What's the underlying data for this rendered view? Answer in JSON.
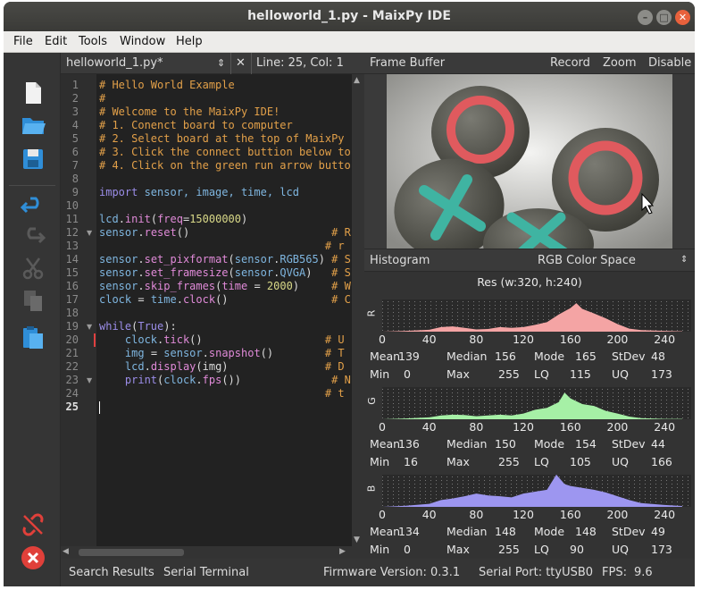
{
  "window": {
    "title": "helloworld_1.py - MaixPy IDE"
  },
  "menu": [
    "File",
    "Edit",
    "Tools",
    "Window",
    "Help"
  ],
  "toolbar_icons": [
    "new-file-icon",
    "open-folder-icon",
    "save-icon",
    "undo-icon",
    "redo-icon",
    "cut-icon",
    "copy-icon",
    "paste-icon",
    "disconnect-icon",
    "stop-icon"
  ],
  "editor": {
    "tab_label": "helloworld_1.py*",
    "position": "Line: 25, Col: 1",
    "current_line": 25,
    "lines": [
      [
        [
          "# Hello World Example",
          "comment"
        ]
      ],
      [
        [
          "#",
          "comment"
        ]
      ],
      [
        [
          "# Welcome to the MaixPy IDE!",
          "comment"
        ]
      ],
      [
        [
          "# 1. Conenct board to computer",
          "comment"
        ]
      ],
      [
        [
          "# 2. Select board at the top of MaixPy",
          "comment"
        ]
      ],
      [
        [
          "# 3. Click the connect buttion below to",
          "comment"
        ]
      ],
      [
        [
          "# 4. Click on the green run arrow butto",
          "comment"
        ]
      ],
      [],
      [
        [
          "import",
          "kw"
        ],
        [
          " sensor, image, time, lcd",
          "var"
        ]
      ],
      [],
      [
        [
          "lcd",
          "var"
        ],
        [
          ".",
          "plain"
        ],
        [
          "init",
          "fn"
        ],
        [
          "(",
          "plain"
        ],
        [
          "freq",
          "fn"
        ],
        [
          "=",
          "plain"
        ],
        [
          "15000000",
          "num"
        ],
        [
          ")",
          "plain"
        ]
      ],
      [
        [
          "sensor",
          "var"
        ],
        [
          ".",
          "plain"
        ],
        [
          "reset",
          "fn"
        ],
        [
          "()",
          "plain"
        ],
        [
          "                      ",
          "plain"
        ],
        [
          "# R",
          "comment"
        ]
      ],
      [
        [
          "                                   ",
          "plain"
        ],
        [
          "# r",
          "comment"
        ]
      ],
      [
        [
          "sensor",
          "var"
        ],
        [
          ".",
          "plain"
        ],
        [
          "set_pixformat",
          "fn"
        ],
        [
          "(",
          "plain"
        ],
        [
          "sensor",
          "var"
        ],
        [
          ".",
          "plain"
        ],
        [
          "RGB565",
          "var"
        ],
        [
          ")",
          "plain"
        ],
        [
          " ",
          "plain"
        ],
        [
          "# S",
          "comment"
        ]
      ],
      [
        [
          "sensor",
          "var"
        ],
        [
          ".",
          "plain"
        ],
        [
          "set_framesize",
          "fn"
        ],
        [
          "(",
          "plain"
        ],
        [
          "sensor",
          "var"
        ],
        [
          ".",
          "plain"
        ],
        [
          "QVGA",
          "var"
        ],
        [
          ")",
          "plain"
        ],
        [
          "   ",
          "plain"
        ],
        [
          "# S",
          "comment"
        ]
      ],
      [
        [
          "sensor",
          "var"
        ],
        [
          ".",
          "plain"
        ],
        [
          "skip_frames",
          "fn"
        ],
        [
          "(",
          "plain"
        ],
        [
          "time",
          "fn"
        ],
        [
          " = ",
          "plain"
        ],
        [
          "2000",
          "num"
        ],
        [
          ")",
          "plain"
        ],
        [
          "     ",
          "plain"
        ],
        [
          "# W",
          "comment"
        ]
      ],
      [
        [
          "clock",
          "var"
        ],
        [
          " = ",
          "plain"
        ],
        [
          "time",
          "var"
        ],
        [
          ".",
          "plain"
        ],
        [
          "clock",
          "fn"
        ],
        [
          "()",
          "plain"
        ],
        [
          "                ",
          "plain"
        ],
        [
          "# C",
          "comment"
        ]
      ],
      [],
      [
        [
          "while",
          "kw"
        ],
        [
          "(",
          "plain"
        ],
        [
          "True",
          "kw"
        ],
        [
          "):",
          "plain"
        ]
      ],
      [
        [
          "    ",
          "plain"
        ],
        [
          "clock",
          "var"
        ],
        [
          ".",
          "plain"
        ],
        [
          "tick",
          "fn"
        ],
        [
          "()",
          "plain"
        ],
        [
          "                   ",
          "plain"
        ],
        [
          "# U",
          "comment"
        ]
      ],
      [
        [
          "    ",
          "plain"
        ],
        [
          "img",
          "var"
        ],
        [
          " = ",
          "plain"
        ],
        [
          "sensor",
          "var"
        ],
        [
          ".",
          "plain"
        ],
        [
          "snapshot",
          "fn"
        ],
        [
          "()",
          "plain"
        ],
        [
          "        ",
          "plain"
        ],
        [
          "# T",
          "comment"
        ]
      ],
      [
        [
          "    ",
          "plain"
        ],
        [
          "lcd",
          "var"
        ],
        [
          ".",
          "plain"
        ],
        [
          "display",
          "fn"
        ],
        [
          "(img)",
          "plain"
        ],
        [
          "               ",
          "plain"
        ],
        [
          "# D",
          "comment"
        ]
      ],
      [
        [
          "    ",
          "plain"
        ],
        [
          "print",
          "kw"
        ],
        [
          "(",
          "plain"
        ],
        [
          "clock",
          "var"
        ],
        [
          ".",
          "plain"
        ],
        [
          "fps",
          "fn"
        ],
        [
          "())",
          "plain"
        ],
        [
          "              ",
          "plain"
        ],
        [
          "# N",
          "comment"
        ]
      ],
      [
        [
          "                                   ",
          "plain"
        ],
        [
          "# t",
          "comment"
        ]
      ],
      []
    ],
    "fold_lines": [
      12,
      19,
      23
    ]
  },
  "frame_buffer": {
    "label": "Frame Buffer",
    "record": "Record",
    "zoom": "Zoom",
    "disable": "Disable"
  },
  "histogram": {
    "label": "Histogram",
    "color_space": "RGB Color Space",
    "resolution": "Res (w:320, h:240)",
    "x_ticks": [
      "0",
      "40",
      "80",
      "120",
      "160",
      "200",
      "240"
    ],
    "channels": [
      {
        "letter": "R",
        "color": "#f4a4a4",
        "mean": "139",
        "median": "156",
        "mode": "165",
        "stdev": "48",
        "min": "0",
        "max": "255",
        "lq": "115",
        "uq": "173"
      },
      {
        "letter": "G",
        "color": "#a6f0a6",
        "mean": "136",
        "median": "150",
        "mode": "154",
        "stdev": "44",
        "min": "16",
        "max": "255",
        "lq": "105",
        "uq": "166"
      },
      {
        "letter": "B",
        "color": "#9d96f0",
        "mean": "134",
        "median": "148",
        "mode": "148",
        "stdev": "49",
        "min": "0",
        "max": "255",
        "lq": "90",
        "uq": "173"
      }
    ],
    "stat_labels": {
      "mean": "Mean",
      "median": "Median",
      "mode": "Mode",
      "stdev": "StDev",
      "min": "Min",
      "max": "Max",
      "lq": "LQ",
      "uq": "UQ"
    }
  },
  "chart_data": [
    {
      "type": "area",
      "name": "R",
      "x": [
        0,
        20,
        40,
        50,
        60,
        70,
        80,
        90,
        100,
        110,
        120,
        130,
        140,
        150,
        160,
        165,
        170,
        180,
        190,
        200,
        210,
        220,
        240,
        255
      ],
      "values": [
        0,
        2,
        5,
        12,
        14,
        10,
        6,
        7,
        12,
        10,
        12,
        18,
        25,
        45,
        62,
        75,
        60,
        48,
        35,
        20,
        8,
        4,
        2,
        1
      ],
      "xlim": [
        0,
        255
      ]
    },
    {
      "type": "area",
      "name": "G",
      "x": [
        0,
        20,
        40,
        50,
        60,
        70,
        80,
        90,
        100,
        110,
        120,
        130,
        140,
        150,
        155,
        160,
        170,
        180,
        190,
        200,
        210,
        220,
        240,
        255
      ],
      "values": [
        0,
        2,
        5,
        10,
        12,
        11,
        8,
        10,
        12,
        10,
        15,
        25,
        30,
        45,
        70,
        55,
        40,
        35,
        22,
        15,
        7,
        3,
        1,
        1
      ],
      "xlim": [
        0,
        255
      ]
    },
    {
      "type": "area",
      "name": "B",
      "x": [
        0,
        20,
        40,
        50,
        60,
        70,
        80,
        90,
        100,
        110,
        120,
        130,
        140,
        148,
        155,
        160,
        170,
        180,
        190,
        200,
        210,
        220,
        240,
        255
      ],
      "values": [
        0,
        3,
        8,
        18,
        22,
        28,
        35,
        30,
        28,
        25,
        35,
        40,
        45,
        85,
        60,
        55,
        50,
        45,
        38,
        28,
        18,
        10,
        5,
        2
      ],
      "xlim": [
        0,
        255
      ]
    }
  ],
  "status": {
    "search": "Search Results",
    "serial": "Serial Terminal",
    "firmware": "Firmware Version: 0.3.1",
    "port": "Serial Port: ttyUSB0",
    "fps_label": "FPS:",
    "fps": "9.6"
  }
}
